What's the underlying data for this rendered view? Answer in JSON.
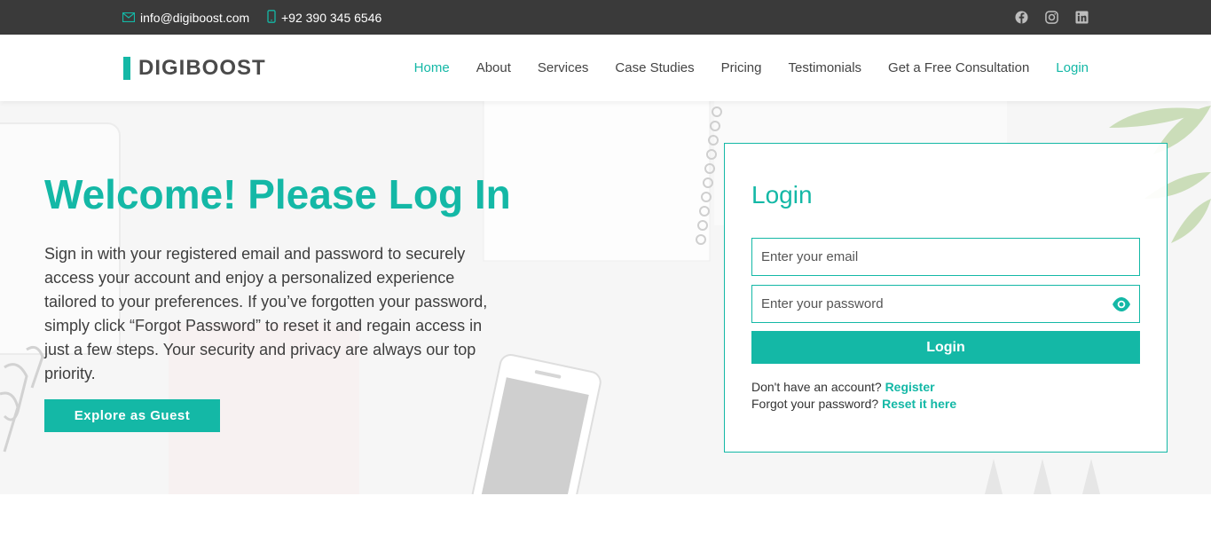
{
  "topbar": {
    "email": "info@digiboost.com",
    "phone": "+92 390 345 6546",
    "socials": [
      "facebook-icon",
      "instagram-icon",
      "linkedin-icon"
    ]
  },
  "header": {
    "logo": "DIGIBOOST",
    "nav": [
      {
        "label": "Home",
        "active": true
      },
      {
        "label": "About"
      },
      {
        "label": "Services"
      },
      {
        "label": "Case Studies"
      },
      {
        "label": "Pricing"
      },
      {
        "label": "Testimonials"
      },
      {
        "label": "Get a Free Consultation"
      },
      {
        "label": "Login",
        "highlight": true
      }
    ]
  },
  "hero": {
    "title": "Welcome! Please Log In",
    "text": "Sign in with your registered email and password to securely access your account and enjoy a personalized experience tailored to your preferences. If you’ve forgotten your password, simply click “Forgot Password” to reset it and regain access in just a few steps. Your security and privacy are always our top priority.",
    "guest_button": "Explore as Guest"
  },
  "login": {
    "title": "Login",
    "email_placeholder": "Enter your email",
    "password_placeholder": "Enter your password",
    "submit": "Login",
    "no_account": "Don't have an account?",
    "register": "Register",
    "forgot": "Forgot your password?",
    "reset": "Reset it here"
  },
  "colors": {
    "accent": "#14b8a6",
    "topbar": "#3a3a3a"
  }
}
